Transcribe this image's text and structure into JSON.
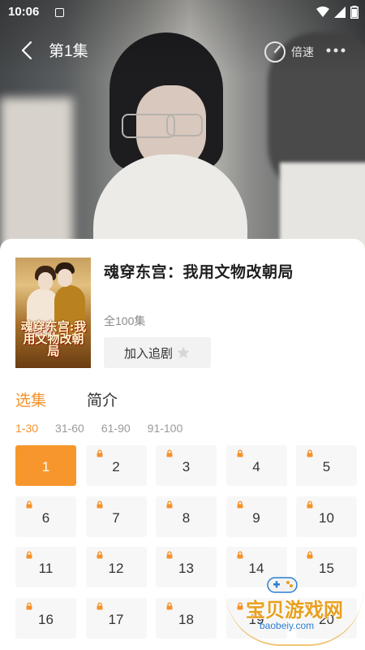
{
  "status_bar": {
    "time": "10:06"
  },
  "player": {
    "episode_title": "第1集",
    "speed_label": "倍速",
    "icons": {
      "back": "back-chevron-icon",
      "speed": "speed-gauge-icon",
      "more": "more-dots-icon"
    }
  },
  "drama": {
    "title": "魂穿东宫：我用文物改朝局",
    "poster_title": "魂穿东宫:我用文物改朝局",
    "episode_count": "全100集",
    "follow_label": "加入追剧",
    "follow_icon": "star-icon"
  },
  "tabs": [
    {
      "label": "选集",
      "active": true
    },
    {
      "label": "简介",
      "active": false
    }
  ],
  "ranges": [
    {
      "label": "1-30",
      "active": true
    },
    {
      "label": "31-60",
      "active": false
    },
    {
      "label": "61-90",
      "active": false
    },
    {
      "label": "91-100",
      "active": false
    }
  ],
  "episodes": [
    {
      "num": "1",
      "locked": false,
      "active": true
    },
    {
      "num": "2",
      "locked": true,
      "active": false
    },
    {
      "num": "3",
      "locked": true,
      "active": false
    },
    {
      "num": "4",
      "locked": true,
      "active": false
    },
    {
      "num": "5",
      "locked": true,
      "active": false
    },
    {
      "num": "6",
      "locked": true,
      "active": false
    },
    {
      "num": "7",
      "locked": true,
      "active": false
    },
    {
      "num": "8",
      "locked": true,
      "active": false
    },
    {
      "num": "9",
      "locked": true,
      "active": false
    },
    {
      "num": "10",
      "locked": true,
      "active": false
    },
    {
      "num": "11",
      "locked": true,
      "active": false
    },
    {
      "num": "12",
      "locked": true,
      "active": false
    },
    {
      "num": "13",
      "locked": true,
      "active": false
    },
    {
      "num": "14",
      "locked": true,
      "active": false
    },
    {
      "num": "15",
      "locked": true,
      "active": false
    },
    {
      "num": "16",
      "locked": true,
      "active": false
    },
    {
      "num": "17",
      "locked": true,
      "active": false
    },
    {
      "num": "18",
      "locked": true,
      "active": false
    },
    {
      "num": "19",
      "locked": true,
      "active": false
    },
    {
      "num": "20",
      "locked": true,
      "active": false
    }
  ],
  "colors": {
    "accent": "#f5922a",
    "tile_bg": "#f7f7f7",
    "text": "#333333"
  },
  "watermark": {
    "text": "宝贝游戏网",
    "url": "baobeiy.com"
  }
}
